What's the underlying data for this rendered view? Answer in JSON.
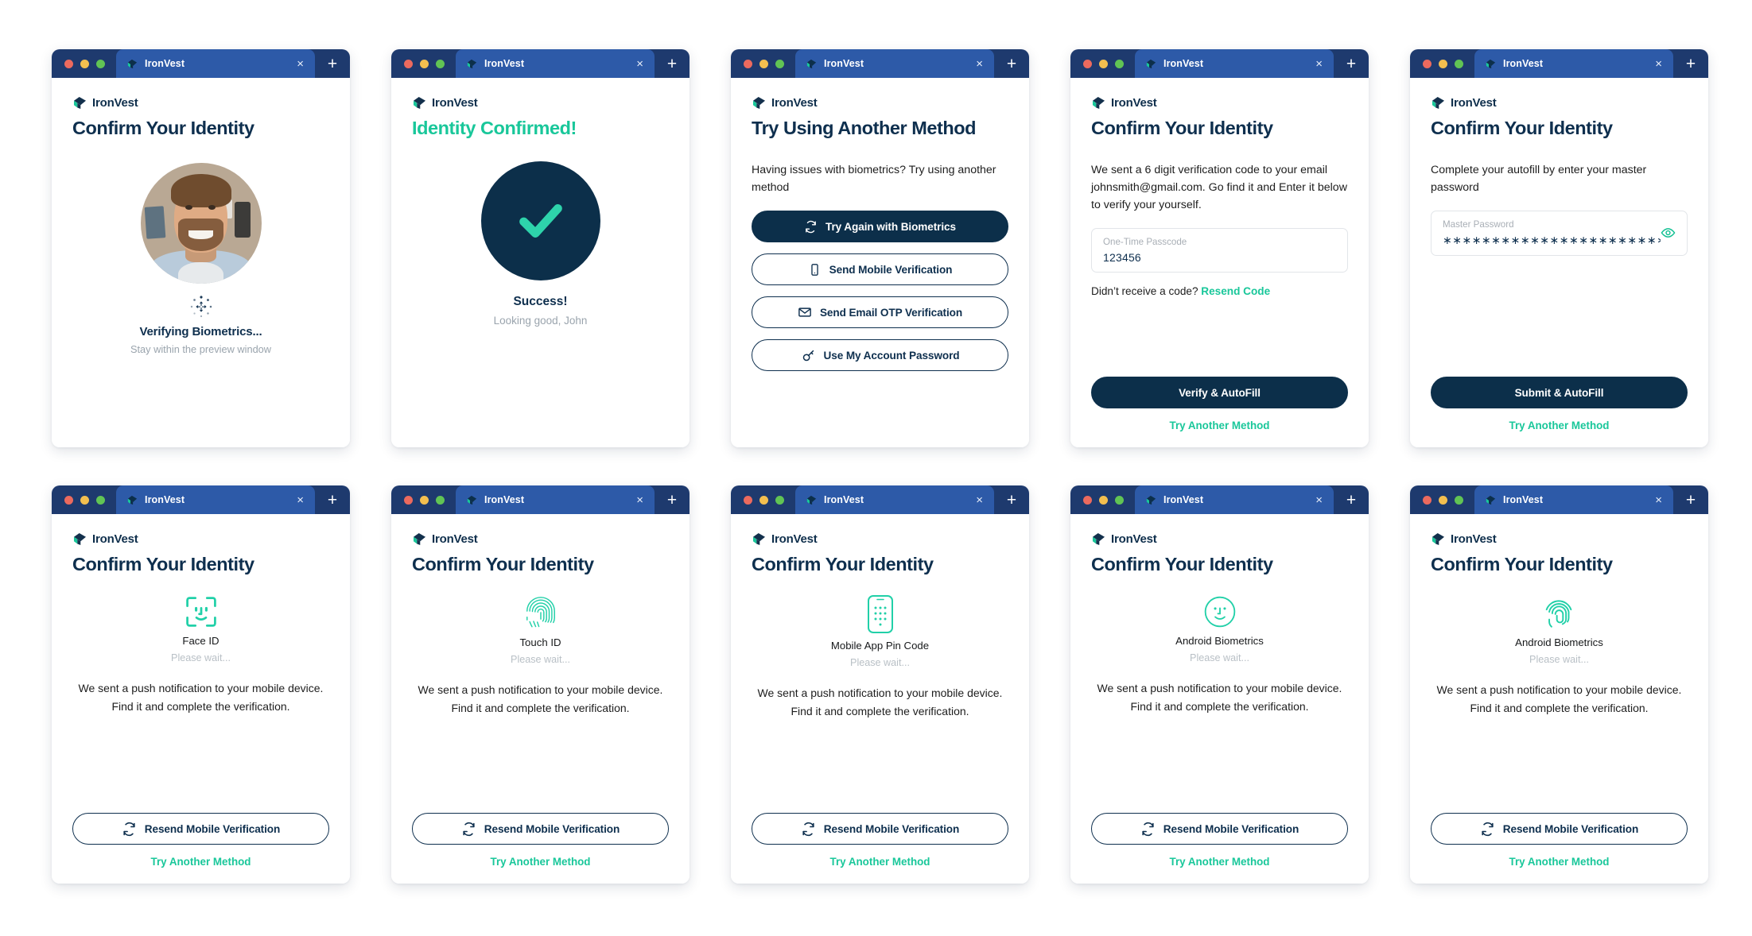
{
  "brand": {
    "name": "IronVest",
    "logo_icon": "ironvest-logo-icon"
  },
  "window_chrome": {
    "tab_title": "IronVest",
    "close_label": "×",
    "new_tab_label": "+",
    "traffic_lights": [
      "close-red",
      "minimize-yellow",
      "maximize-green"
    ]
  },
  "colors": {
    "navy": "#0e2f4e",
    "deep_navy": "#0c2f4a",
    "titlebar": "#1e3a6e",
    "tab_active": "#2d5aa8",
    "teal": "#19c79a",
    "muted": "#9aa4ad",
    "border": "#e2e5e9"
  },
  "cards": [
    {
      "id": "verifying-biometrics",
      "title": "Confirm Your Identity",
      "title_style": "navy",
      "avatar": {
        "alt": "user-face-photo"
      },
      "spinner_icon": "loading-spinner-icon",
      "status_main": "Verifying Biometrics...",
      "status_sub": "Stay within the preview window"
    },
    {
      "id": "identity-confirmed",
      "title": "Identity Confirmed!",
      "title_style": "teal",
      "check_icon": "check-mark-icon",
      "success_title": "Success!",
      "success_sub": "Looking good, John"
    },
    {
      "id": "try-another-method",
      "title": "Try Using Another Method",
      "title_style": "navy",
      "lead": "Having issues with biometrics? Try using another method",
      "buttons": [
        {
          "label": "Try Again with Biometrics",
          "icon": "refresh-icon",
          "style": "primary"
        },
        {
          "label": "Send Mobile Verification",
          "icon": "mobile-phone-icon",
          "style": "outline"
        },
        {
          "label": "Send Email OTP Verification",
          "icon": "envelope-icon",
          "style": "outline"
        },
        {
          "label": "Use My Account Password",
          "icon": "key-icon",
          "style": "outline"
        }
      ]
    },
    {
      "id": "email-otp",
      "title": "Confirm Your Identity",
      "title_style": "navy",
      "lead": "We sent a 6 digit verification code to your email johnsmith@gmail.com. Go find it and Enter it below to verify your yourself.",
      "field": {
        "label": "One-Time Passcode",
        "value": "123456",
        "placeholder": "One-Time Passcode"
      },
      "resend_prefix": "Didn’t receive a code? ",
      "resend_link": "Resend Code",
      "submit_label": "Verify & AutoFill",
      "alt_link": "Try Another Method"
    },
    {
      "id": "master-password",
      "title": "Confirm Your Identity",
      "title_style": "navy",
      "lead": "Complete your autofill by enter your master password",
      "field": {
        "label": "Master Password",
        "value": "∗∗∗∗∗∗∗∗∗∗∗∗∗∗∗∗∗∗∗∗∗∗∗∗∗∗",
        "placeholder": "Master Password",
        "reveal_icon": "eye-icon"
      },
      "submit_label": "Submit & AutoFill",
      "alt_link": "Try Another Method"
    },
    {
      "id": "face-id",
      "title": "Confirm Your Identity",
      "title_style": "navy",
      "method": {
        "icon": "face-id-icon",
        "name": "Face ID",
        "wait": "Please wait..."
      },
      "push_text": "We sent a push notification to your mobile device. Find it and complete the verification.",
      "resend_label": "Resend Mobile Verification",
      "resend_icon": "refresh-icon",
      "alt_link": "Try Another Method"
    },
    {
      "id": "touch-id",
      "title": "Confirm Your Identity",
      "title_style": "navy",
      "method": {
        "icon": "fingerprint-icon",
        "name": "Touch ID",
        "wait": "Please wait..."
      },
      "push_text": "We sent a push notification to your mobile device. Find it and complete the verification.",
      "resend_label": "Resend Mobile Verification",
      "resend_icon": "refresh-icon",
      "alt_link": "Try Another Method"
    },
    {
      "id": "mobile-app-pin",
      "title": "Confirm Your Identity",
      "title_style": "navy",
      "method": {
        "icon": "mobile-keypad-icon",
        "name": "Mobile App Pin Code",
        "wait": "Please wait..."
      },
      "push_text": "We sent a push notification to your mobile device. Find it and complete the verification.",
      "resend_label": "Resend Mobile Verification",
      "resend_icon": "refresh-icon",
      "alt_link": "Try Another Method"
    },
    {
      "id": "android-face",
      "title": "Confirm Your Identity",
      "title_style": "navy",
      "method": {
        "icon": "android-face-icon",
        "name": "Android Biometrics",
        "wait": "Please wait..."
      },
      "push_text": "We sent a push notification to your mobile device. Find it and complete the verification.",
      "resend_label": "Resend Mobile Verification",
      "resend_icon": "refresh-icon",
      "alt_link": "Try Another Method"
    },
    {
      "id": "android-fingerprint",
      "title": "Confirm Your Identity",
      "title_style": "navy",
      "method": {
        "icon": "android-fingerprint-icon",
        "name": "Android Biometrics",
        "wait": "Please wait..."
      },
      "push_text": "We sent a push notification to your mobile device. Find it and complete the verification.",
      "resend_label": "Resend Mobile Verification",
      "resend_icon": "refresh-icon",
      "alt_link": "Try Another Method"
    }
  ]
}
